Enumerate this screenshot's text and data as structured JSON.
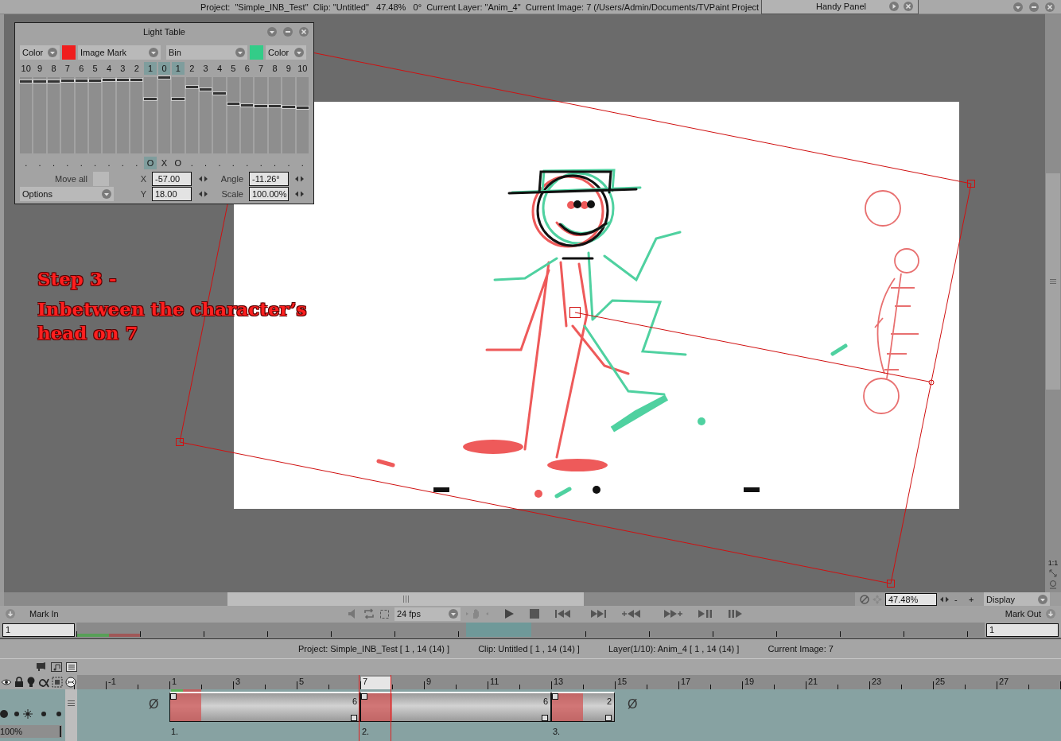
{
  "title_bar": {
    "text": "Project:  \"Simple_INB_Test\"  Clip: \"Untitled\"   47.48%   0°  Current Layer: \"Anim_4\"  Current Image: 7 (/Users/Admin/Documents/TVPaint Project",
    "handy_panel": "Handy Panel"
  },
  "caption": {
    "heading": "Step 3 -",
    "text": "Inbetween the character’s head on 7"
  },
  "light_table": {
    "title": "Light Table",
    "left_mode": "Color",
    "mark_mode": "Image Mark",
    "bin": "Bin",
    "right_mode": "Color",
    "columns": [
      {
        "label": "10",
        "selected": false,
        "level": 0.95,
        "mark": ".",
        "mark_selected": false
      },
      {
        "label": "9",
        "selected": false,
        "level": 0.95,
        "mark": ".",
        "mark_selected": false
      },
      {
        "label": "8",
        "selected": false,
        "level": 0.95,
        "mark": ".",
        "mark_selected": false
      },
      {
        "label": "7",
        "selected": false,
        "level": 0.96,
        "mark": ".",
        "mark_selected": false
      },
      {
        "label": "6",
        "selected": false,
        "level": 0.96,
        "mark": ".",
        "mark_selected": false
      },
      {
        "label": "5",
        "selected": false,
        "level": 0.96,
        "mark": ".",
        "mark_selected": false
      },
      {
        "label": "4",
        "selected": false,
        "level": 0.97,
        "mark": ".",
        "mark_selected": false
      },
      {
        "label": "3",
        "selected": false,
        "level": 0.97,
        "mark": ".",
        "mark_selected": false
      },
      {
        "label": "2",
        "selected": false,
        "level": 0.97,
        "mark": ".",
        "mark_selected": false
      },
      {
        "label": "1",
        "selected": true,
        "level": 0.72,
        "mark": "O",
        "mark_selected": true
      },
      {
        "label": "0",
        "selected": true,
        "level": 1,
        "mark": "X",
        "mark_selected": false
      },
      {
        "label": "1",
        "selected": true,
        "level": 0.72,
        "mark": "O",
        "mark_selected": false
      },
      {
        "label": "2",
        "selected": false,
        "level": 0.87,
        "mark": ".",
        "mark_selected": false
      },
      {
        "label": "3",
        "selected": false,
        "level": 0.84,
        "mark": ".",
        "mark_selected": false
      },
      {
        "label": "4",
        "selected": false,
        "level": 0.79,
        "mark": ".",
        "mark_selected": false
      },
      {
        "label": "5",
        "selected": false,
        "level": 0.66,
        "mark": ".",
        "mark_selected": false
      },
      {
        "label": "6",
        "selected": false,
        "level": 0.64,
        "mark": ".",
        "mark_selected": false
      },
      {
        "label": "7",
        "selected": false,
        "level": 0.63,
        "mark": ".",
        "mark_selected": false
      },
      {
        "label": "8",
        "selected": false,
        "level": 0.62,
        "mark": ".",
        "mark_selected": false
      },
      {
        "label": "9",
        "selected": false,
        "level": 0.61,
        "mark": ".",
        "mark_selected": false
      },
      {
        "label": "10",
        "selected": false,
        "level": 0.6,
        "mark": ".",
        "mark_selected": false
      }
    ],
    "move_all": "Move all",
    "options": "Options",
    "fields": [
      {
        "label": "X",
        "value": "-57.00"
      },
      {
        "label": "Angle",
        "value": "-11.26°"
      },
      {
        "label": "Y",
        "value": "18.00"
      },
      {
        "label": "Scale",
        "value": "100.00%"
      }
    ]
  },
  "viewport_tools": {
    "label": "1:1"
  },
  "zoom": {
    "value": "47.48%",
    "minus": "-",
    "plus": "+",
    "display": "Display"
  },
  "transport": {
    "mark_in": "Mark In",
    "fps": "24 fps",
    "mark_out": "Mark Out",
    "mark_in_value": "1",
    "mark_out_value": "1"
  },
  "timeline": {
    "info": [
      "Project: Simple_INB_Test [ 1 , 14  (14) ]",
      "Clip: Untitled [ 1 , 14  (14) ]",
      "Layer(1/10): Anim_4 [ 1 , 14  (14) ]",
      "Current Image: 7"
    ],
    "opacity": {
      "value": "100%",
      "level": 1
    },
    "ruler": [
      {
        "label": "-1",
        "selected": false
      },
      {
        "label": "1",
        "selected": false
      },
      {
        "label": "3",
        "selected": false
      },
      {
        "label": "5",
        "selected": false
      },
      {
        "label": "7",
        "selected": true
      },
      {
        "label": "9",
        "selected": false
      },
      {
        "label": "11",
        "selected": false
      },
      {
        "label": "13",
        "selected": false
      },
      {
        "label": "15",
        "selected": false
      },
      {
        "label": "17",
        "selected": false
      },
      {
        "label": "19",
        "selected": false
      },
      {
        "label": "21",
        "selected": false
      },
      {
        "label": "23",
        "selected": false
      },
      {
        "label": "25",
        "selected": false
      },
      {
        "label": "27",
        "selected": false
      }
    ],
    "empty_before": "Ø",
    "empty_after": "Ø",
    "instances": [
      {
        "number": "1.",
        "length": "6"
      },
      {
        "number": "2.",
        "length": "6"
      },
      {
        "number": "3.",
        "length": "2"
      }
    ]
  }
}
